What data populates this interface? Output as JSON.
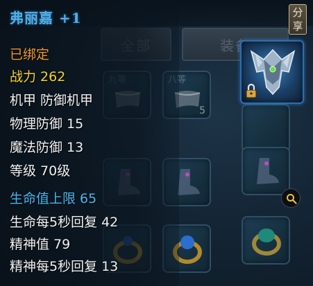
{
  "item": {
    "name": "弗丽嘉 +1",
    "bound": "已绑定",
    "power_label": "战力",
    "power_value": "262",
    "type_label": "机甲",
    "type_value": "防御机甲",
    "phys_def_label": "物理防御",
    "phys_def_value": "15",
    "mag_def_label": "魔法防御",
    "mag_def_value": "13",
    "level_label": "等级",
    "level_value": "70级",
    "hp_limit_label": "生命值上限",
    "hp_limit_value": "65",
    "hp_regen_label": "生命每5秒回复",
    "hp_regen_value": "42",
    "spirit_label": "精神值",
    "spirit_value": "79",
    "spirit_regen_label": "精神每5秒回复",
    "spirit_regen_value": "13",
    "icon": "armor-icon",
    "locked": true
  },
  "share": {
    "label_top": "分",
    "label_bottom": "享"
  },
  "inventory": {
    "tab_all": "全部",
    "tab_partial": "装备",
    "slot_labels": [
      "九等",
      "八等"
    ],
    "slot_count": "5"
  },
  "colors": {
    "name": "#4fb0e8",
    "bound": "#f2962d",
    "power": "#f4d230",
    "hp_limit": "#48b8ee",
    "stat_text": "#f1f1f1"
  }
}
